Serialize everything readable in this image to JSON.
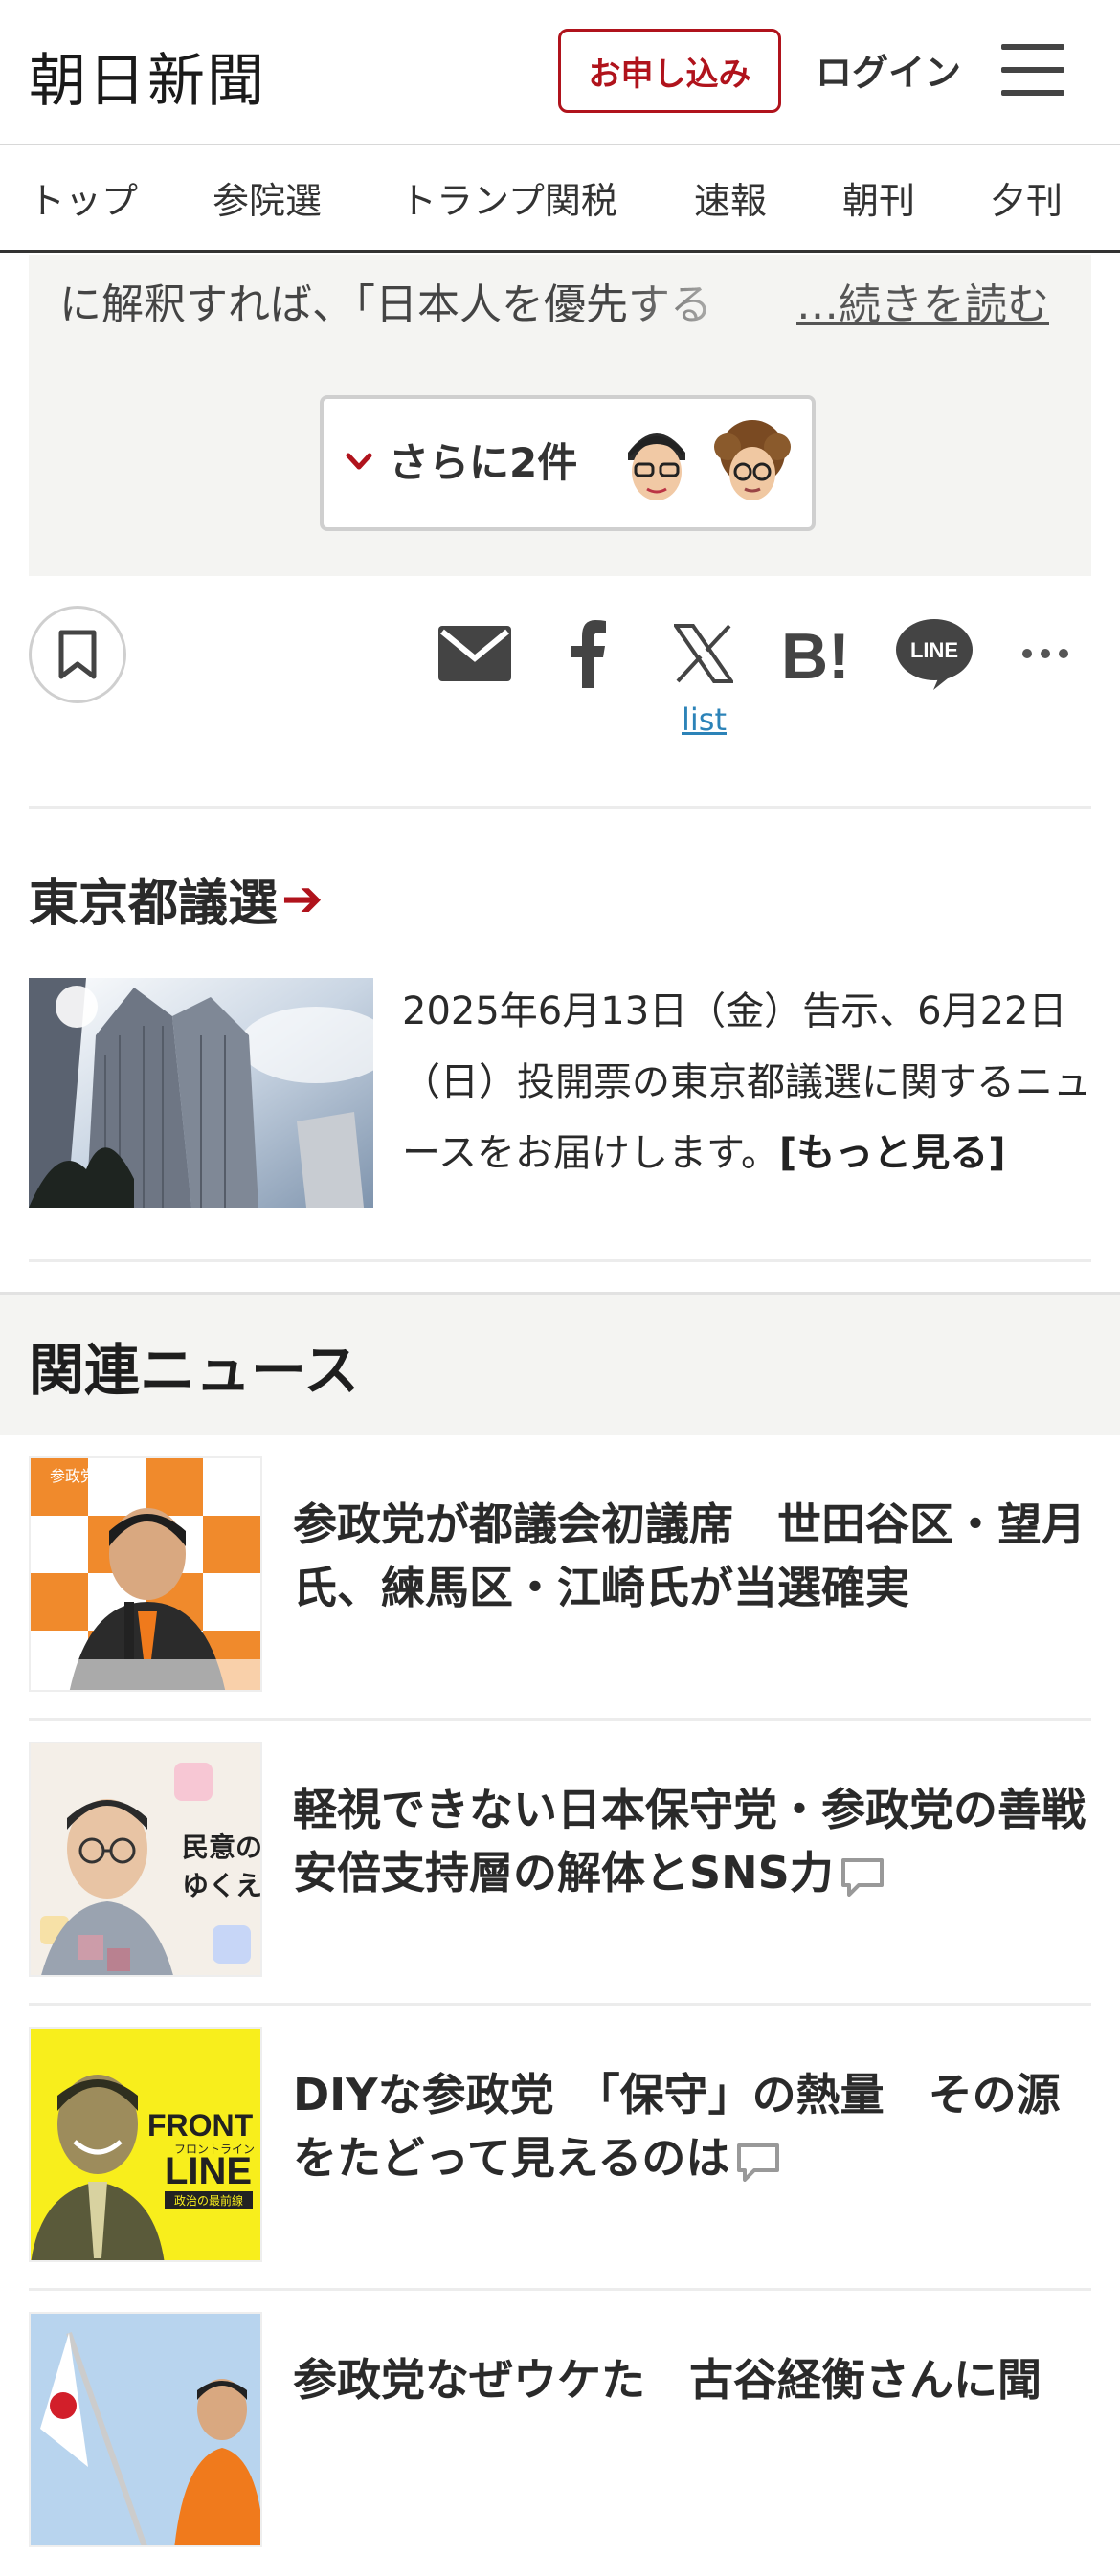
{
  "header": {
    "logo": "朝日新聞",
    "apply_label": "お申し込み",
    "login_label": "ログイン"
  },
  "nav": {
    "items": [
      "トップ",
      "参院選",
      "トランプ関税",
      "速報",
      "朝刊",
      "夕刊"
    ]
  },
  "article_tail": {
    "text": "に解釈すれば、「日本人を優先する",
    "read_more": "…続きを読む",
    "more_comments": "さらに2件"
  },
  "share": {
    "list_label": "list",
    "icons": [
      "bookmark-icon",
      "mail-icon",
      "facebook-icon",
      "x-icon",
      "hatena-bookmark-icon",
      "line-icon",
      "more-icon"
    ]
  },
  "tokyo_section": {
    "title": "東京都議選",
    "arrow": "➔",
    "description": "2025年6月13日（金）告示、6月22日（日）投開票の東京都議選に関するニュースをお届けします。",
    "more_link": "[もっと見る]"
  },
  "related": {
    "title": "関連ニュース",
    "items": [
      {
        "title": "参政党が都議会初議席　世田谷区・望月氏、練馬区・江崎氏が当選確実",
        "has_comment": false
      },
      {
        "title": "軽視できない日本保守党・参政党の善戦　安倍支持層の解体とSNS力",
        "has_comment": true
      },
      {
        "title": "DIYな参政党　「保守」の熱量　その源をたどって見えるのは",
        "has_comment": true
      },
      {
        "title": "参政党なぜウケた　古谷経衡さんに聞",
        "has_comment": false
      }
    ]
  },
  "thumb_text": {
    "minsei_1": "民意の",
    "minsei_2": "ゆくえ",
    "front_line_1": "FRONT",
    "front_line_2": "LINE",
    "front_line_sub": "フロントライン",
    "front_line_caption": "政治の最前線",
    "party_banner": "参政党"
  },
  "colors": {
    "accent": "#b0131c",
    "link": "#2c83b8",
    "section_bg": "#f4f4f2"
  }
}
